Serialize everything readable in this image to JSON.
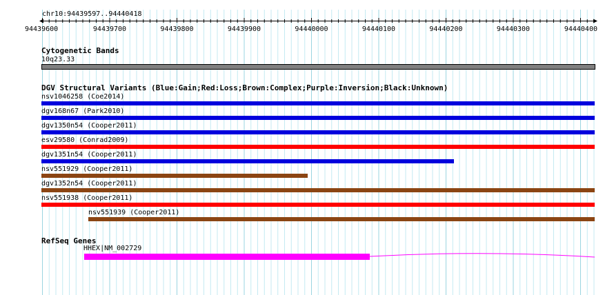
{
  "ruler": {
    "region": "chr10:94439597..94440418",
    "ticks": [
      "94439600",
      "94439700",
      "94439800",
      "94439900",
      "94440000",
      "94440100",
      "94440200",
      "94440300",
      "94440400"
    ]
  },
  "tracks": {
    "cytoband": {
      "title": "Cytogenetic Bands",
      "band_label": "10q23.33",
      "color": "#808080"
    },
    "dgv": {
      "title": "DGV Structural Variants (Blue:Gain;Red:Loss;Brown:Complex;Purple:Inversion;Black:Unknown)",
      "variants": [
        {
          "label": "nsv1046258 (Coe2014)",
          "color": "#0000dd"
        },
        {
          "label": "dgv168n67 (Park2010)",
          "color": "#0000dd"
        },
        {
          "label": "dgv1350n54 (Cooper2011)",
          "color": "#0000dd"
        },
        {
          "label": "esv29580 (Conrad2009)",
          "color": "#ff0000"
        },
        {
          "label": "dgv1351n54 (Cooper2011)",
          "color": "#0000dd"
        },
        {
          "label": "nsv551929 (Cooper2011)",
          "color": "#8b4513"
        },
        {
          "label": "dgv1352n54 (Cooper2011)",
          "color": "#8b4513"
        },
        {
          "label": "nsv551938 (Cooper2011)",
          "color": "#ff0000"
        },
        {
          "label": "nsv551939 (Cooper2011)",
          "color": "#8b4513"
        }
      ]
    },
    "refseq": {
      "title": "RefSeq Genes",
      "gene_label": "HHEX|NM_002729",
      "color": "#ff00ff"
    }
  }
}
